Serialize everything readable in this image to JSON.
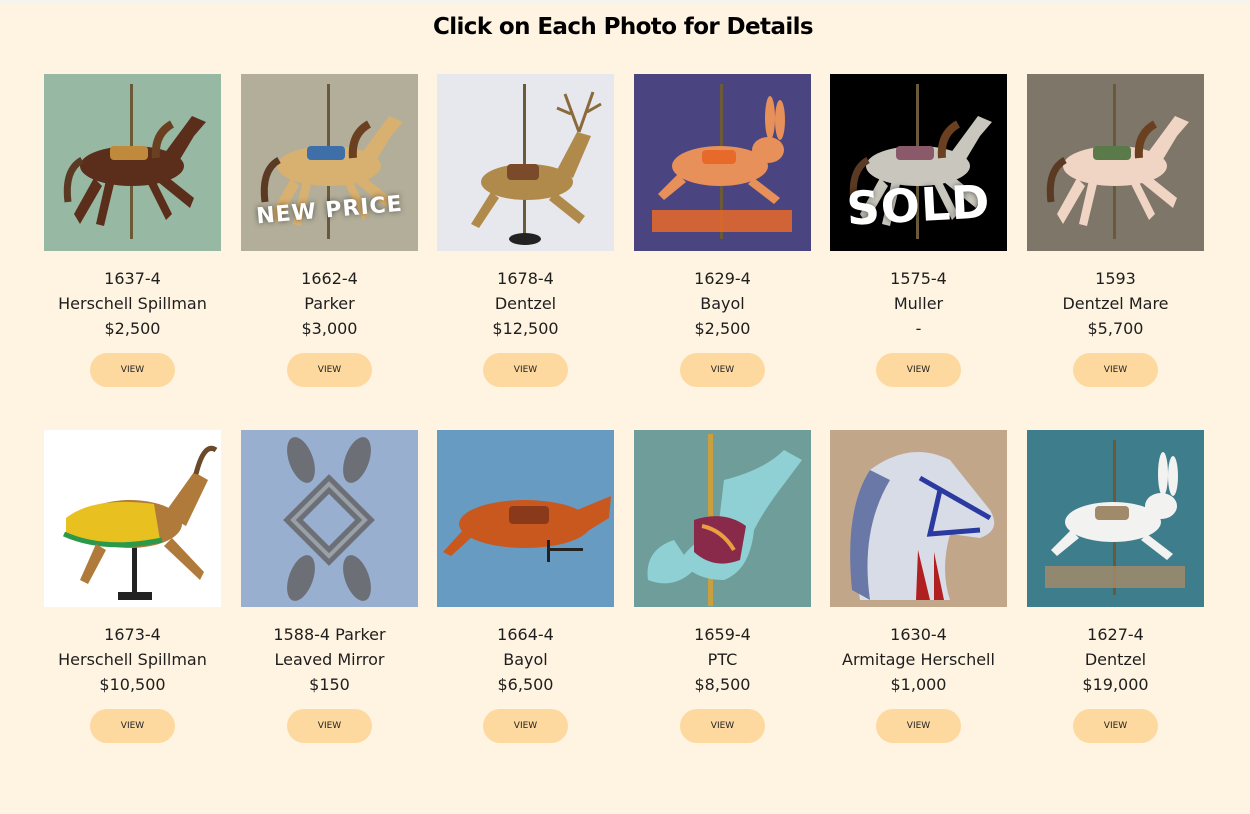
{
  "page": {
    "title": "Click on Each Photo for Details",
    "button_label": "VIEW"
  },
  "rows": [
    [
      {
        "id": "1637-4",
        "name": "Herschell Spillman",
        "price": "$2,500",
        "bg": "#97b8a3",
        "figure": "horse",
        "color": "#5a2e1a",
        "accent": "#c08a3c",
        "overlay": ""
      },
      {
        "id": "1662-4",
        "name": "Parker",
        "price": "$3,000",
        "bg": "#b2ae9a",
        "figure": "horse",
        "color": "#d8b070",
        "accent": "#3f6fa8",
        "overlay": "NEW PRICE"
      },
      {
        "id": "1678-4",
        "name": "Dentzel",
        "price": "$12,500",
        "bg": "#e6e8ee",
        "figure": "deer",
        "color": "#b08a4a",
        "accent": "#7a4a2a",
        "overlay": ""
      },
      {
        "id": "1629-4",
        "name": "Bayol",
        "price": "$2,500",
        "bg": "#4a4580",
        "figure": "rabbit",
        "color": "#e8905a",
        "accent": "#e86a2a",
        "overlay": ""
      },
      {
        "id": "1575-4",
        "name": "Muller",
        "price": "-",
        "bg": "#000000",
        "figure": "horse",
        "color": "#c9c7bd",
        "accent": "#8a5a6a",
        "overlay": "SOLD"
      },
      {
        "id": "1593",
        "name": "Dentzel Mare",
        "price": "$5,700",
        "bg": "#7d7669",
        "figure": "horse",
        "color": "#f0d4c4",
        "accent": "#5a7a4a",
        "overlay": ""
      }
    ],
    [
      {
        "id": "1673-4",
        "name": "Herschell Spillman",
        "price": "$10,500",
        "bg": "#ffffff",
        "figure": "goat",
        "color": "#b07a3a",
        "accent": "#e8c020",
        "overlay": ""
      },
      {
        "id": "1588-4 Parker",
        "name": "Leaved Mirror",
        "price": "$150",
        "bg": "#98afd0",
        "figure": "mirror",
        "color": "#6c6f76",
        "accent": "#9aa0a8",
        "overlay": ""
      },
      {
        "id": "1664-4",
        "name": "Bayol",
        "price": "$6,500",
        "bg": "#679bc2",
        "figure": "pig",
        "color": "#c8581e",
        "accent": "#8a3a1a",
        "overlay": ""
      },
      {
        "id": "1659-4",
        "name": "PTC",
        "price": "$8,500",
        "bg": "#6f9e9a",
        "figure": "seahorse",
        "color": "#8fd0d4",
        "accent": "#8a2a4a",
        "overlay": ""
      },
      {
        "id": "1630-4",
        "name": "Armitage Herschell",
        "price": "$1,000",
        "bg": "#c2a68a",
        "figure": "horsehead",
        "color": "#d8dce6",
        "accent": "#2a3aa0",
        "overlay": ""
      },
      {
        "id": "1627-4",
        "name": "Dentzel",
        "price": "$19,000",
        "bg": "#3e7d8c",
        "figure": "rabbit",
        "color": "#f2f2f0",
        "accent": "#a08a6a",
        "overlay": ""
      }
    ]
  ]
}
